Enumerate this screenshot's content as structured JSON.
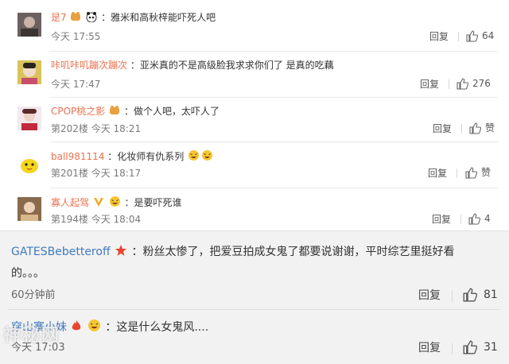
{
  "comments": [
    {
      "user": "是7",
      "text": "：雅米和高秋梓能吓死人吧",
      "meta": "今天 17:55",
      "reply": "回复",
      "likes": "64"
    },
    {
      "user": "咔叽咔叽蹦次蹦次",
      "text": "：亚米真的不是高级脸我求求你们了  是真的吃藕",
      "meta": "今天 17:47",
      "reply": "回复",
      "likes": "276"
    },
    {
      "user": "CPOP桃之影",
      "text": "：做个人吧，太吓人了",
      "meta": "第202楼  今天 18:21",
      "reply": "回复",
      "likes": "赞"
    },
    {
      "user": "ball981114",
      "text": "：化妆师有仇系列",
      "meta": "第201楼  今天 18:17",
      "reply": "回复",
      "likes": "赞"
    },
    {
      "user": "寡人起驾",
      "text": "：是要吓死谁",
      "meta": "第194楼  今天 18:04",
      "reply": "回复",
      "likes": "4"
    }
  ],
  "comments2": [
    {
      "user": "GATESBebetteroff",
      "text": "：粉丝太惨了，把爱豆拍成女鬼了都要说谢谢，平时综艺里挺好看",
      "text2": "的。。。",
      "meta": "60分钟前",
      "reply": "回复",
      "likes": "81"
    },
    {
      "user": "穿山寨小妹",
      "text": "：这是什么女鬼风....",
      "meta": "今天 17:03",
      "reply": "回复",
      "likes": "31"
    }
  ],
  "watermark": "神秘网",
  "colors": {
    "username": "#eb7350",
    "username_blue": "#3f7abf",
    "meta": "#7a7a7a"
  }
}
